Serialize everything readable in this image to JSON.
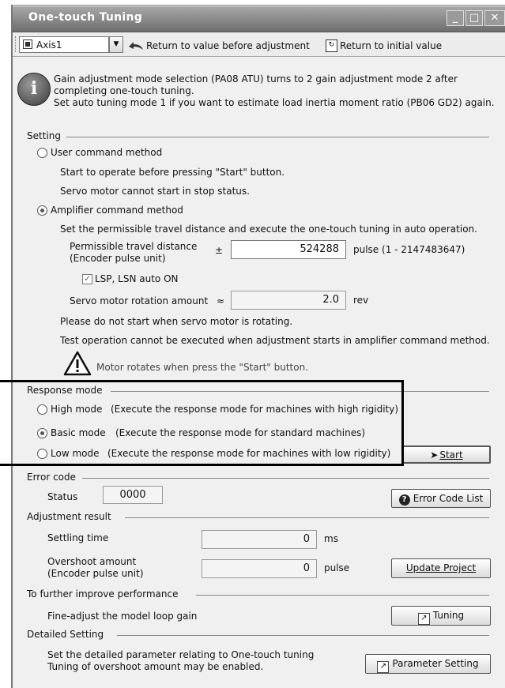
{
  "window": {
    "title": "One-touch Tuning"
  },
  "toolbar": {
    "axis": "Axis1",
    "return_before": "Return to value before adjustment",
    "return_initial": "Return to initial value"
  },
  "info": {
    "line1": "Gain adjustment mode selection (PA08 ATU) turns to 2 gain adjustment mode 2 after",
    "line2": "completing one-touch tuning.",
    "line3": "Set auto tuning mode 1 if you want to estimate load inertia moment ratio (PB06 GD2) again."
  },
  "setting": {
    "label": "Setting",
    "user_method": "User command method",
    "user_desc1": "Start to operate before pressing \"Start\" button.",
    "user_desc2": "Servo motor cannot start in stop status.",
    "amp_method": "Amplifier command method",
    "amp_desc": "Set the permissible travel distance and execute the one-touch tuning in auto operation.",
    "travel_label1": "Permissible travel distance",
    "travel_label2": "(Encoder pulse unit)",
    "travel_pm": "±",
    "travel_value": "524288",
    "travel_unit": "pulse (1 - 2147483647)",
    "lsp_label": "LSP, LSN auto ON",
    "rotation_label": "Servo motor rotation amount",
    "rotation_approx": "≈",
    "rotation_value": "2.0",
    "rotation_unit": "rev",
    "warn1": "Please do not start when servo motor is rotating.",
    "warn2": "Test operation cannot be executed when adjustment starts in amplifier command method.",
    "caution": "Motor rotates when press the \"Start\" button."
  },
  "response": {
    "label": "Response mode",
    "high": "High mode",
    "high_desc": "(Execute the response mode for machines with high rigidity)",
    "basic": "Basic mode",
    "basic_desc": "(Execute the response mode for standard machines)",
    "low": "Low mode",
    "low_desc": "(Execute the response mode for machines with low rigidity)",
    "start": "Start"
  },
  "error": {
    "label": "Error code",
    "status_label": "Status",
    "status_value": "0000",
    "list_button": "Error Code List"
  },
  "result": {
    "label": "Adjustment result",
    "settling_label": "Settling time",
    "settling_value": "0",
    "settling_unit": "ms",
    "overshoot_label1": "Overshoot amount",
    "overshoot_label2": "(Encoder pulse unit)",
    "overshoot_value": "0",
    "overshoot_unit": "pulse",
    "update_button": "Update Project"
  },
  "improve": {
    "label": "To further improve performance",
    "desc": "Fine-adjust the model loop gain",
    "button": "Tuning"
  },
  "detailed": {
    "label": "Detailed Setting",
    "desc1": "Set the detailed parameter relating to One-touch tuning",
    "desc2": "Tuning of overshoot amount may be enabled.",
    "button": "Parameter Setting"
  }
}
